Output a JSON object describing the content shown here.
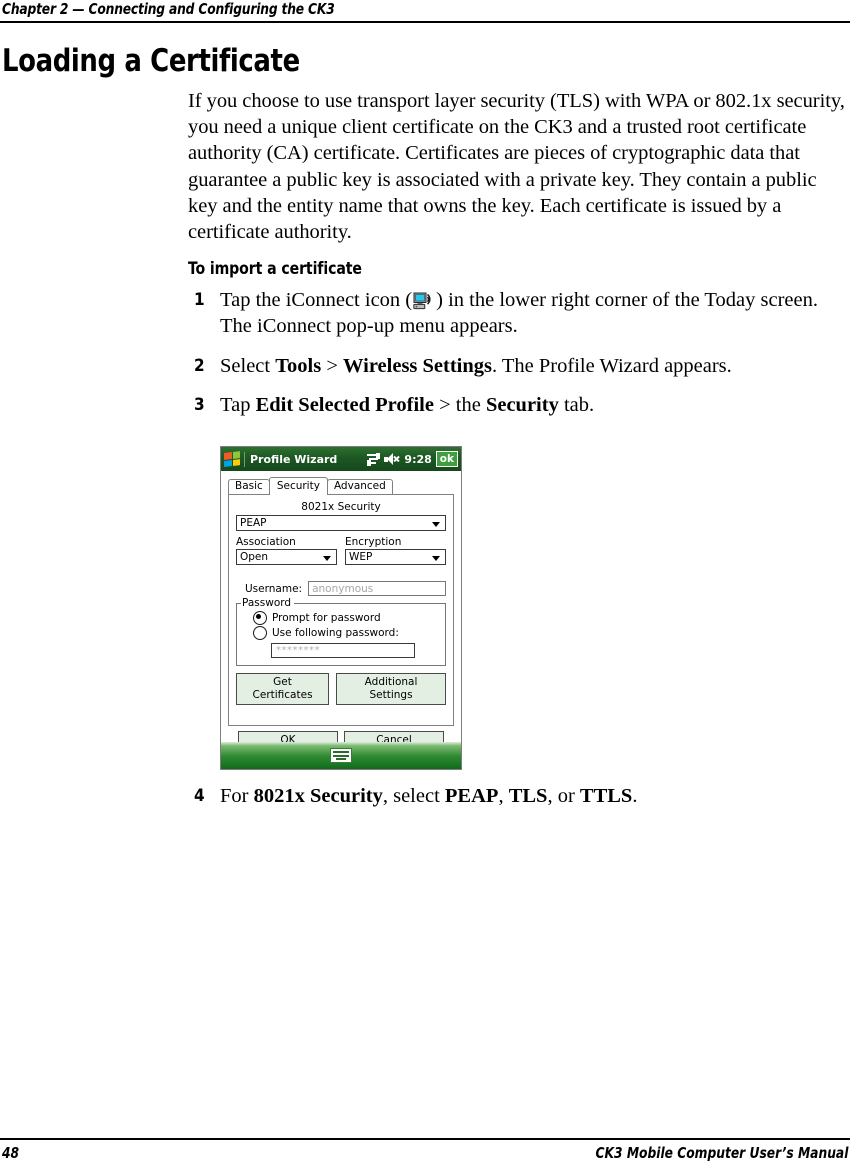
{
  "header": {
    "chapter_title": "Chapter 2 — Connecting and Configuring the CK3"
  },
  "heading": {
    "h1": "Loading a Certificate",
    "h3": "To import a certificate"
  },
  "intro": {
    "paragraph": "If you choose to use transport layer security (TLS) with WPA or 802.1x security, you need a unique client certificate on the CK3 and a trusted root certificate authority (CA) certificate. Certificates are pieces of cryptographic data that guarantee a public key is associated with a private key. They contain a public key and the entity name that owns the key. Each certificate is issued by a certificate authority."
  },
  "steps": [
    {
      "number": "1",
      "parts": [
        {
          "text": "Tap the iConnect icon (",
          "bold": false
        },
        {
          "icon": "iconnect-icon"
        },
        {
          "text": ") in the lower right corner of the Today screen. The iConnect pop-up menu appears.",
          "bold": false
        }
      ]
    },
    {
      "number": "2",
      "parts": [
        {
          "text": "Select ",
          "bold": false
        },
        {
          "text": "Tools",
          "bold": true
        },
        {
          "text": " > ",
          "bold": false
        },
        {
          "text": "Wireless Settings",
          "bold": true
        },
        {
          "text": ". The Profile Wizard appears.",
          "bold": false
        }
      ]
    },
    {
      "number": "3",
      "parts": [
        {
          "text": "Tap ",
          "bold": false
        },
        {
          "text": "Edit Selected Profile",
          "bold": true
        },
        {
          "text": " > the ",
          "bold": false
        },
        {
          "text": "Security",
          "bold": true
        },
        {
          "text": " tab.",
          "bold": false
        }
      ]
    },
    {
      "number": "4",
      "parts": [
        {
          "text": "For ",
          "bold": false
        },
        {
          "text": "8021x Security",
          "bold": true
        },
        {
          "text": ", select ",
          "bold": false
        },
        {
          "text": "PEAP",
          "bold": true
        },
        {
          "text": ", ",
          "bold": false
        },
        {
          "text": "TLS",
          "bold": true
        },
        {
          "text": ", or ",
          "bold": false
        },
        {
          "text": "TTLS",
          "bold": true
        },
        {
          "text": ".",
          "bold": false
        }
      ]
    }
  ],
  "screenshot": {
    "titlebar": {
      "title": "Profile Wizard",
      "time": "9:28",
      "ok_label": "ok",
      "icons": [
        "start-flag-icon",
        "connectivity-icon",
        "speaker-mute-icon"
      ]
    },
    "tabs": [
      {
        "label": "Basic",
        "active": false
      },
      {
        "label": "Security",
        "active": true
      },
      {
        "label": "Advanced",
        "active": false
      }
    ],
    "security_section_label": "8021x Security",
    "security_type": {
      "value": "PEAP",
      "options": [
        "PEAP",
        "TLS",
        "TTLS"
      ]
    },
    "association": {
      "label": "Association",
      "value": "Open"
    },
    "encryption": {
      "label": "Encryption",
      "value": "WEP"
    },
    "username": {
      "label": "Username:",
      "value": "anonymous"
    },
    "password_group": {
      "title": "Password",
      "option_prompt": "Prompt for password",
      "option_following": "Use following password:",
      "password_masked": "********",
      "selected": "prompt"
    },
    "buttons": {
      "get_certificates": "Get Certificates",
      "additional_settings": "Additional Settings",
      "ok": "OK",
      "cancel": "Cancel"
    },
    "taskbar": {
      "sip_icon": "keyboard-icon"
    },
    "colors": {
      "titlebar_green": "#1d5723",
      "taskbar_green": "#2f8a33",
      "button_face": "#e3efe3",
      "ok_button_green": "#3f9e3f"
    }
  },
  "footer": {
    "page_number": "48",
    "manual_title": "CK3 Mobile Computer User’s Manual"
  }
}
